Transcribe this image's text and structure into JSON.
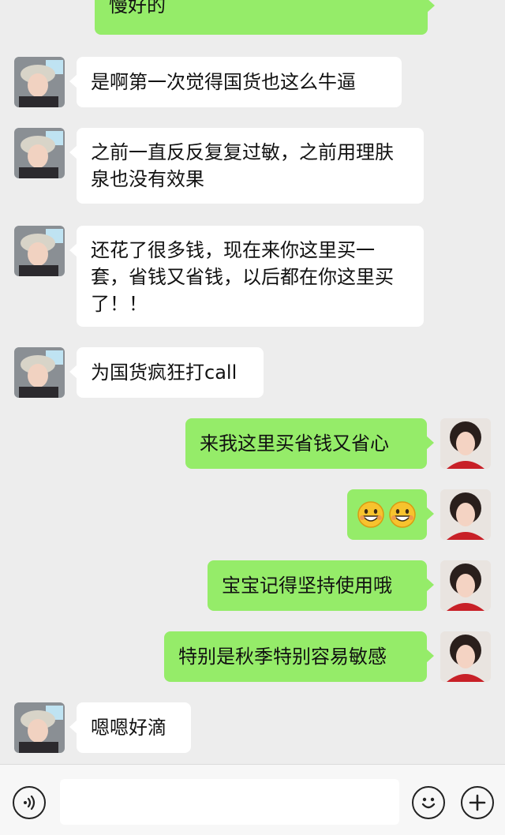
{
  "conversation": {
    "messages": [
      {
        "side": "right",
        "text": "慢好的",
        "avatar": "seller-avatar"
      },
      {
        "side": "left",
        "text": "是啊第一次觉得国货也这么牛逼",
        "avatar": "customer-avatar"
      },
      {
        "side": "left",
        "text": "之前一直反反复复过敏，之前用理肤泉也没有效果",
        "avatar": "customer-avatar"
      },
      {
        "side": "left",
        "text": "还花了很多钱，现在来你这里买一套，省钱又省钱，以后都在你这里买了！！",
        "avatar": "customer-avatar"
      },
      {
        "side": "left",
        "text": "为国货疯狂打call",
        "avatar": "customer-avatar"
      },
      {
        "side": "right",
        "text": "来我这里买省钱又省心",
        "avatar": "seller-avatar"
      },
      {
        "side": "right",
        "text": "",
        "emoji": [
          "grinning-face-icon",
          "grinning-face-icon"
        ],
        "avatar": "seller-avatar"
      },
      {
        "side": "right",
        "text": "宝宝记得坚持使用哦",
        "avatar": "seller-avatar"
      },
      {
        "side": "right",
        "text": "特别是秋季特别容易敏感",
        "avatar": "seller-avatar"
      },
      {
        "side": "left",
        "text": "嗯嗯好滴",
        "avatar": "customer-avatar"
      }
    ]
  },
  "input_bar": {
    "voice_icon": "voice-icon",
    "message_value": "",
    "emoji_icon": "emoji-icon",
    "add_icon": "plus-icon"
  },
  "colors": {
    "background": "#ededed",
    "incoming_bubble": "#ffffff",
    "outgoing_bubble": "#95ec69"
  }
}
